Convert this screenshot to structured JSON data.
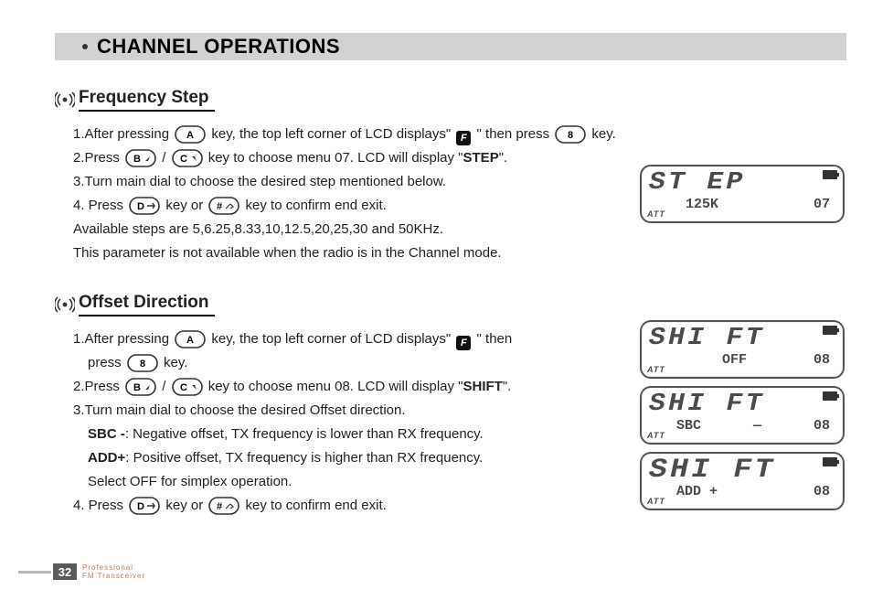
{
  "chapter_title": "CHANNEL OPERATIONS",
  "section1": {
    "title": "Frequency Step",
    "l1a": "1.After pressing ",
    "l1b": " key, the top left corner of LCD displays\" ",
    "l1c": " \" then press ",
    "l1d": " key.",
    "l2a": "2.Press ",
    "l2b": " / ",
    "l2c": " key to choose menu 07. LCD will display \"",
    "l2d": "STEP",
    "l2e": "\".",
    "l3": "3.Turn main dial to choose the desired step mentioned below.",
    "l4a": "4. Press ",
    "l4b": " key or ",
    "l4c": " key to confirm end exit.",
    "l5": "Available steps are 5,6.25,8.33,10,12.5,20,25,30 and 50KHz.",
    "l6": "This parameter is not available when the radio is in the Channel mode."
  },
  "section2": {
    "title": "Offset Direction",
    "l1a": "1.After pressing ",
    "l1b": " key, the top left corner of LCD displays\" ",
    "l1c": " \" then ",
    "l1d": "press ",
    "l1e": " key.",
    "l2a": "2.Press ",
    "l2b": " / ",
    "l2c": " key to choose menu 08. LCD will display \"",
    "l2d": "SHIFT",
    "l2e": "\".",
    "l3": "3.Turn main dial to choose the desired Offset direction.",
    "l3a": "SBC -",
    "l3a2": ": Negative offset, TX frequency is lower than RX frequency.",
    "l3b": "ADD+",
    "l3b2": ": Positive offset, TX frequency is higher than RX frequency.",
    "l3c": "Select OFF for simplex operation.",
    "l4a": "4. Press ",
    "l4b": " key or ",
    "l4c": " key to confirm end exit."
  },
  "keys": {
    "A": "A",
    "B": "B",
    "C": "C",
    "D": "D",
    "8": "8",
    "hash": "#",
    "F": "F"
  },
  "lcd": {
    "att": "ATT",
    "step_big": "ST EP",
    "step_val": "125K",
    "step_menu": "07",
    "shift_big": "SHI FT",
    "off": "OFF",
    "m08": "08",
    "sbc_l": "SBC",
    "sbc_r": "—",
    "add": "ADD +"
  },
  "footer": {
    "page": "32",
    "line1": "Professional",
    "line2": "FM Transceiver"
  }
}
